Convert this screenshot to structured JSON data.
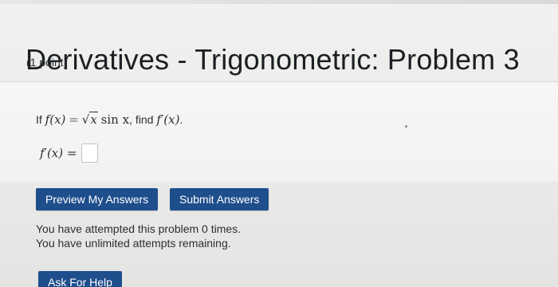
{
  "header": {
    "title": "Derivatives - Trigonometric: Problem 3",
    "points": "(1 point)"
  },
  "problem": {
    "prefix": "If",
    "function_lhs": "f(x)",
    "equals": "=",
    "sqrt_symbol": "√",
    "radicand": "x",
    "function_rhs": "sin x",
    "find_text": ", find",
    "derivative": "f′(x)",
    "end": "."
  },
  "answer": {
    "label": "f′(x) =",
    "value": ""
  },
  "buttons": {
    "preview_label": "Preview My Answers",
    "submit_label": "Submit Answers",
    "help_label": "Ask For Help"
  },
  "status": {
    "attempts_line": "You have attempted this problem 0 times.",
    "remaining_line": "You have unlimited attempts remaining."
  },
  "colors": {
    "button_bg": "#1f4e8c",
    "button_text": "#ffffff"
  }
}
